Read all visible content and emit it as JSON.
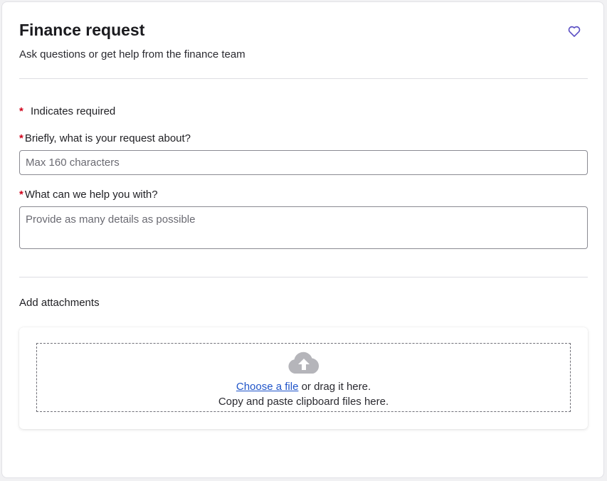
{
  "header": {
    "title": "Finance request",
    "subtitle": "Ask questions or get help from the finance team",
    "favorite_icon": "heart-outline-icon"
  },
  "form": {
    "required_marker": "*",
    "required_note": "Indicates required",
    "fields": [
      {
        "label": "Briefly, what is your request about?",
        "value": "",
        "placeholder": "Max 160 characters",
        "required": true
      },
      {
        "label": "What can we help you with?",
        "value": "",
        "placeholder": "Provide as many details as possible",
        "required": true
      }
    ]
  },
  "attachments": {
    "heading": "Add attachments",
    "upload_icon": "cloud-upload-icon",
    "choose_link": "Choose a file",
    "drag_text": " or drag it here.",
    "paste_text": "Copy and paste clipboard files here."
  },
  "colors": {
    "required": "#d0021b",
    "link": "#1f54c9",
    "favorite_icon": "#5b4fc4",
    "upload_icon": "#b5b5ba"
  }
}
